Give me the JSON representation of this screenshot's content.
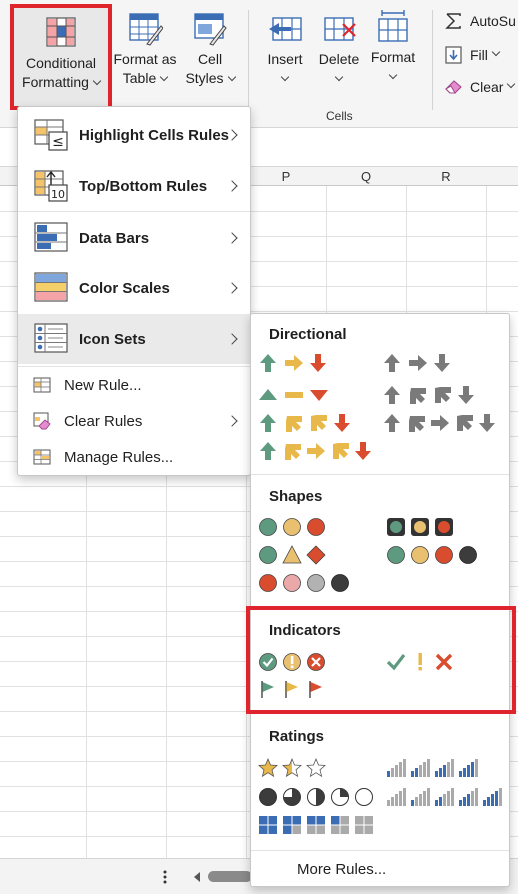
{
  "ribbon": {
    "conditional_formatting": "Conditional",
    "conditional_formatting_2": "Formatting",
    "format_as_table": "Format as",
    "format_as_table_2": "Table",
    "cell_styles": "Cell",
    "cell_styles_2": "Styles",
    "insert": "Insert",
    "delete": "Delete",
    "format": "Format",
    "cells_group": "Cells",
    "autosum": "AutoSu",
    "fill": "Fill",
    "clear": "Clear"
  },
  "columns": [
    "P",
    "Q",
    "R"
  ],
  "menu": {
    "highlight": "Highlight Cells Rules",
    "topbottom": "Top/Bottom Rules",
    "databars": "Data Bars",
    "colorscales": "Color Scales",
    "iconsets": "Icon Sets",
    "newrule": "New Rule...",
    "clearrules": "Clear Rules",
    "managerules": "Manage Rules..."
  },
  "submenu": {
    "directional": "Directional",
    "shapes": "Shapes",
    "indicators": "Indicators",
    "ratings": "Ratings",
    "more_rules": "More Rules..."
  },
  "icon_badges": {
    "leq": "≤",
    "ten": "10"
  },
  "colors": {
    "highlight_red": "#e0242b",
    "green": "#5e9a80",
    "yellow": "#e8b84a",
    "red": "#d94c2e",
    "gray": "#7a7a7a",
    "blue": "#3b6db5"
  }
}
